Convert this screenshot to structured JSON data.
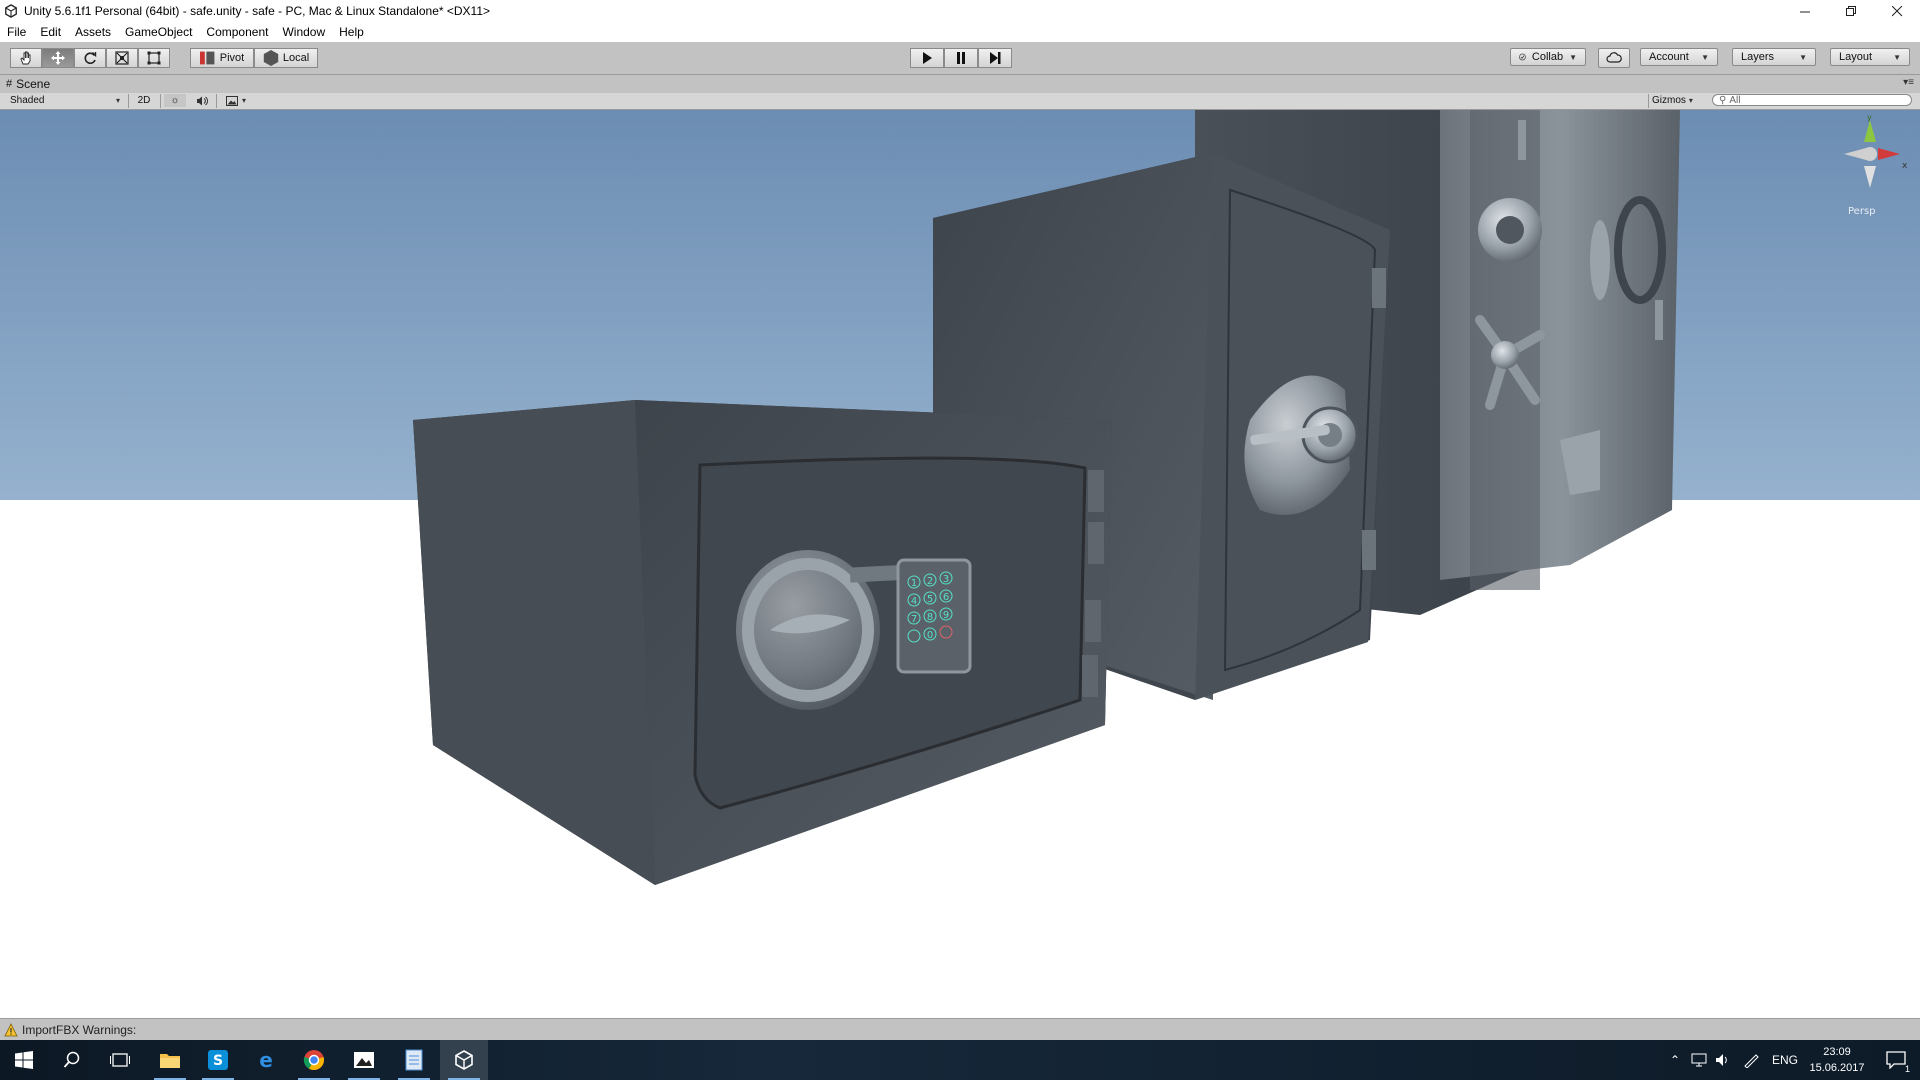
{
  "window": {
    "title": "Unity 5.6.1f1 Personal (64bit) - safe.unity - safe - PC, Mac & Linux Standalone* <DX11>",
    "controls": [
      "minimize",
      "restore",
      "close"
    ]
  },
  "menu": [
    "File",
    "Edit",
    "Assets",
    "GameObject",
    "Component",
    "Window",
    "Help"
  ],
  "toolbar": {
    "transform_tools": [
      "hand-icon",
      "move-icon",
      "rotate-icon",
      "scale-icon",
      "rect-tool-icon"
    ],
    "active_tool": "move-icon",
    "pivot_label": "Pivot",
    "local_label": "Local",
    "playback": [
      "play-icon",
      "pause-icon",
      "step-icon"
    ],
    "collab_label": "Collab",
    "account_label": "Account",
    "layers_label": "Layers",
    "layout_label": "Layout"
  },
  "scene": {
    "tab_label": "Scene",
    "shading_mode": "Shaded",
    "twod_label": "2D",
    "gizmos_label": "Gizmos",
    "search_placeholder": "All",
    "gizmo_axes": [
      "x",
      "y"
    ],
    "projection_label": "Persp",
    "keypad_keys": [
      "1",
      "2",
      "3",
      "4",
      "5",
      "6",
      "7",
      "8",
      "9",
      "",
      "0",
      ""
    ]
  },
  "status": {
    "message": "ImportFBX Warnings:"
  },
  "taskbar": {
    "apps": [
      "windows-start-icon",
      "search-icon",
      "task-view-icon",
      "file-explorer-icon",
      "skype-icon",
      "edge-icon",
      "chrome-icon",
      "photos-icon",
      "notepad-icon",
      "unity-icon"
    ],
    "language": "ENG",
    "time": "23:09",
    "date": "15.06.2017",
    "notification_count": "1"
  },
  "colors": {
    "toolbar_bg": "#c2c2c2",
    "sky_top": "#6e8fb4",
    "ground": "#ffffff",
    "safe_metal": "#4a5058",
    "taskbar_bg": "#0f1f2e"
  }
}
